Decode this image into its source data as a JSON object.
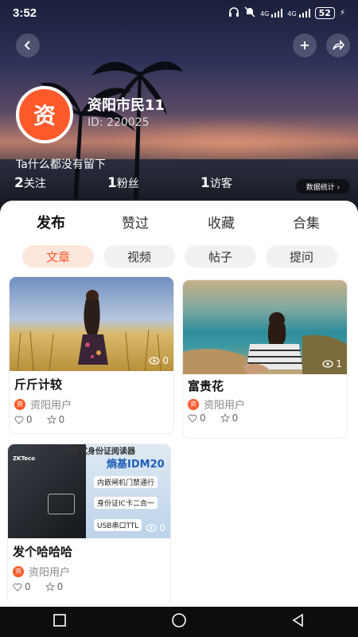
{
  "status_bar": {
    "time": "3:52",
    "battery": "52",
    "net1": "4G",
    "net2": "4G"
  },
  "profile": {
    "avatar_char": "资",
    "name": "资阳市民11",
    "id": "ID: 220025",
    "bio": "Ta什么都没有留下",
    "stats": [
      {
        "count": "2",
        "label": "关注"
      },
      {
        "count": "1",
        "label": "粉丝"
      },
      {
        "count": "1",
        "label": "访客"
      }
    ],
    "data_stats_label": "数据统计 ›"
  },
  "tabs": [
    "发布",
    "赞过",
    "收藏",
    "合集"
  ],
  "chips": [
    "文章",
    "视频",
    "帖子",
    "提问"
  ],
  "posts": [
    {
      "title": "斤斤计较",
      "author": "资阳用户",
      "author_char": "资",
      "views": "0",
      "likes": "0",
      "stars": "0"
    },
    {
      "title": "富贵花",
      "author": "资阳用户",
      "author_char": "资",
      "views": "1",
      "likes": "0",
      "stars": "0"
    },
    {
      "title": "发个哈哈哈",
      "author": "资阳用户",
      "author_char": "资",
      "views": "0",
      "likes": "0",
      "stars": "0",
      "ad_lines": [
        "内置式身份证阅读器",
        "熵基IDM20",
        "内嵌闸机门禁通行",
        "身份证IC卡二合一",
        "USB串口TTL",
        "ZKTeco"
      ]
    }
  ],
  "colors": {
    "accent": "#ff5a2b",
    "chip_active_bg": "#fde6dc"
  },
  "icons": {
    "back": "back-icon",
    "add": "plus-icon",
    "share": "share-icon",
    "views": "eye-icon",
    "like": "heart-icon",
    "star": "star-icon"
  }
}
